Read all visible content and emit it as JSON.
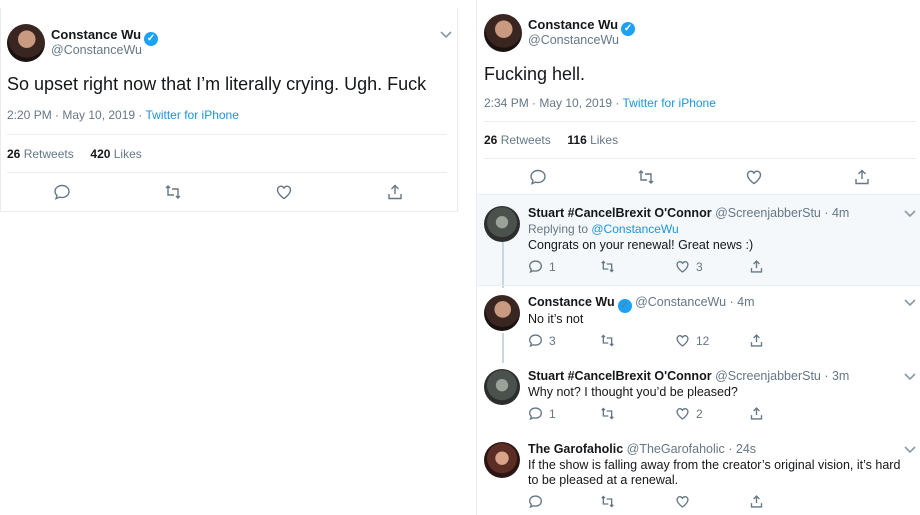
{
  "left_tweet": {
    "name": "Constance Wu",
    "handle": "@ConstanceWu",
    "text": "So upset right now that I’m literally crying. Ugh. Fuck",
    "time": "2:20 PM · May 10, 2019 · ",
    "source": "Twitter for iPhone",
    "retweets": "26",
    "retweets_label": " Retweets",
    "likes": "420",
    "likes_label": " Likes"
  },
  "right_tweet": {
    "name": "Constance Wu",
    "handle": "@ConstanceWu",
    "text": "Fucking hell.",
    "time": "2:34 PM · May 10, 2019 · ",
    "source": "Twitter for iPhone",
    "retweets": "26",
    "retweets_label": " Retweets",
    "likes": "116",
    "likes_label": " Likes"
  },
  "replies": [
    {
      "name": "Stuart #CancelBrexit O'Connor",
      "handle": "@ScreenjabberStu · 4m",
      "replying_to_label": "Replying to ",
      "replying_to": "@ConstanceWu",
      "text": "Congrats on your renewal! Great news :)",
      "reply_count": "1",
      "like_count": "3"
    },
    {
      "name": "Constance Wu",
      "handle": "@ConstanceWu · 4m",
      "text": "No it’s not",
      "reply_count": "3",
      "like_count": "12"
    },
    {
      "name": "Stuart #CancelBrexit O'Connor",
      "handle": "@ScreenjabberStu · 3m",
      "text": "Why not? I thought you’d be pleased?",
      "reply_count": "1",
      "like_count": "2"
    },
    {
      "name": "The Garofaholic",
      "handle": "@TheGarofaholic · 24s",
      "text": "If the show is falling away from the creator’s original vision, it’s hard to be pleased at a renewal."
    }
  ],
  "icons": {
    "verified": "✓"
  },
  "colors": {
    "link": "#1b95e0",
    "verified": "#1da1f2",
    "muted": "#657786",
    "highlight_bg": "#f5f8fa"
  }
}
